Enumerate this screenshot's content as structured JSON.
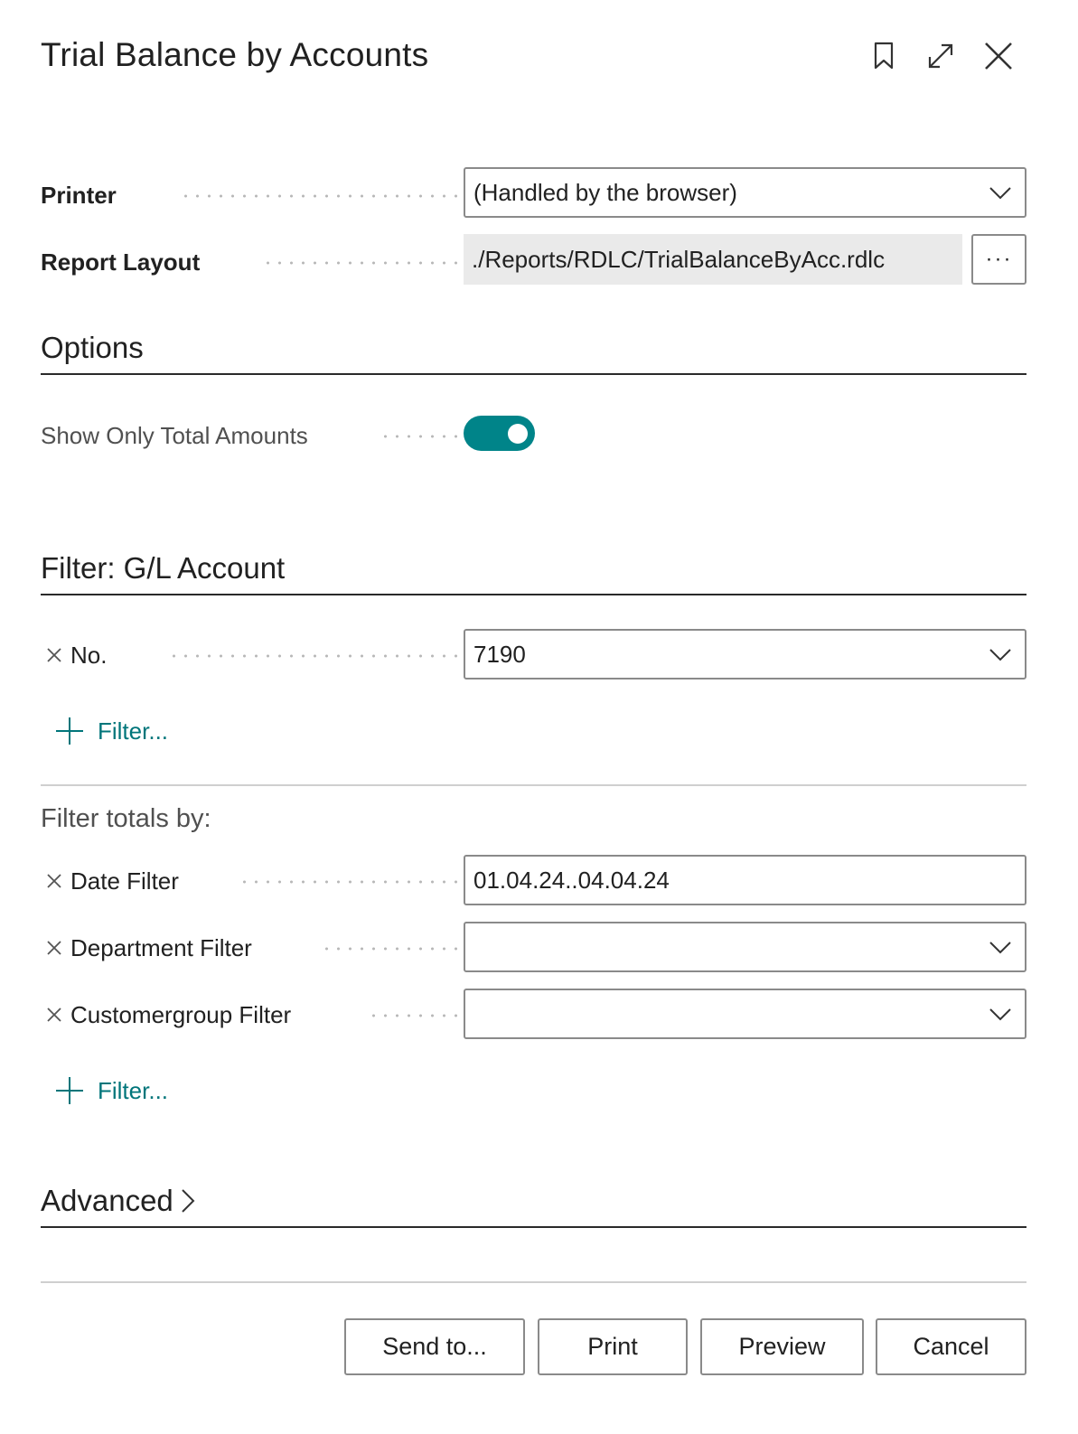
{
  "dialog": {
    "title": "Trial Balance by Accounts"
  },
  "header_icons": [
    "bookmark-icon",
    "expand-icon",
    "close-icon"
  ],
  "printer": {
    "label": "Printer",
    "value": "(Handled by the browser)"
  },
  "report_layout": {
    "label": "Report Layout",
    "value": "./Reports/RDLC/TrialBalanceByAcc.rdlc",
    "assist_label": "···"
  },
  "options": {
    "title": "Options",
    "show_only_total_amounts": {
      "label": "Show Only Total Amounts",
      "checked": true
    }
  },
  "filter_gl": {
    "title": "Filter: G/L Account",
    "no": {
      "label": "No.",
      "value": "7190"
    },
    "add_filter_label": "Filter..."
  },
  "filter_totals": {
    "title": "Filter totals by:",
    "date_filter": {
      "label": "Date Filter",
      "value": "01.04.24..04.04.24"
    },
    "department_filter": {
      "label": "Department Filter",
      "value": ""
    },
    "customergroup_filter": {
      "label": "Customergroup Filter",
      "value": ""
    },
    "add_filter_label": "Filter..."
  },
  "advanced": {
    "title": "Advanced"
  },
  "buttons": {
    "send_to": "Send to...",
    "print": "Print",
    "preview": "Preview",
    "cancel": "Cancel"
  },
  "colors": {
    "accent": "#008489",
    "link": "#00757a"
  }
}
